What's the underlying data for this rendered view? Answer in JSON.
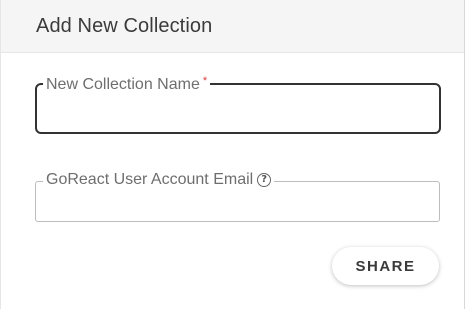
{
  "dialog": {
    "title": "Add New Collection"
  },
  "form": {
    "collection_name": {
      "label": "New Collection Name",
      "required_mark": "*",
      "value": "",
      "placeholder": ""
    },
    "user_email": {
      "label": "GoReact User Account Email",
      "help_icon_glyph": "?",
      "value": "",
      "placeholder": ""
    }
  },
  "actions": {
    "share_label": "SHARE"
  },
  "icons": {
    "help": "help-circle-icon"
  },
  "colors": {
    "active_border": "#333333",
    "required": "#d93b3b",
    "header_background": "#f5f5f5"
  }
}
